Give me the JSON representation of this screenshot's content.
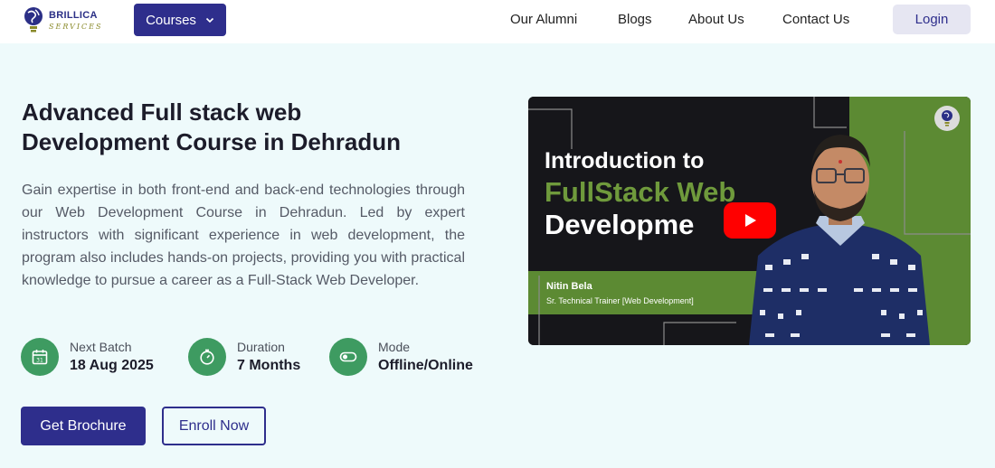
{
  "header": {
    "logo_name": "BRILLICA",
    "logo_sub": "SERVICES",
    "courses_label": "Courses",
    "nav": [
      "Our Alumni",
      "Blogs",
      "About Us",
      "Contact Us"
    ],
    "login_label": "Login"
  },
  "hero": {
    "title_line1": "Advanced Full stack web",
    "title_line2": "Development Course in Dehradun",
    "description": "Gain expertise in both front-end and back-end technologies through our Web Development Course in Dehradun. Led by expert instructors with significant experience in web development, the program also includes hands-on projects, providing you with practical knowledge to pursue a career as a Full-Stack Web Developer.",
    "stats": [
      {
        "label": "Next Batch",
        "value": "18 Aug 2025",
        "icon": "calendar-icon",
        "icon_text": "31"
      },
      {
        "label": "Duration",
        "value": "7 Months",
        "icon": "stopwatch-icon"
      },
      {
        "label": "Mode",
        "value": "Offline/Online",
        "icon": "toggle-icon"
      }
    ],
    "brochure_label": "Get Brochure",
    "enroll_label": "Enroll Now"
  },
  "video": {
    "line1": "Introduction to",
    "line2": "FullStack Web",
    "line3": "Developme",
    "presenter_name": "Nitin Bela",
    "presenter_role": "Sr. Technical Trainer [Web Development]"
  },
  "colors": {
    "brand": "#2e2e8c",
    "accent_green": "#3e9b61",
    "video_green": "#6f9a3c",
    "play_red": "#ff0000",
    "background": "#eefafb"
  }
}
